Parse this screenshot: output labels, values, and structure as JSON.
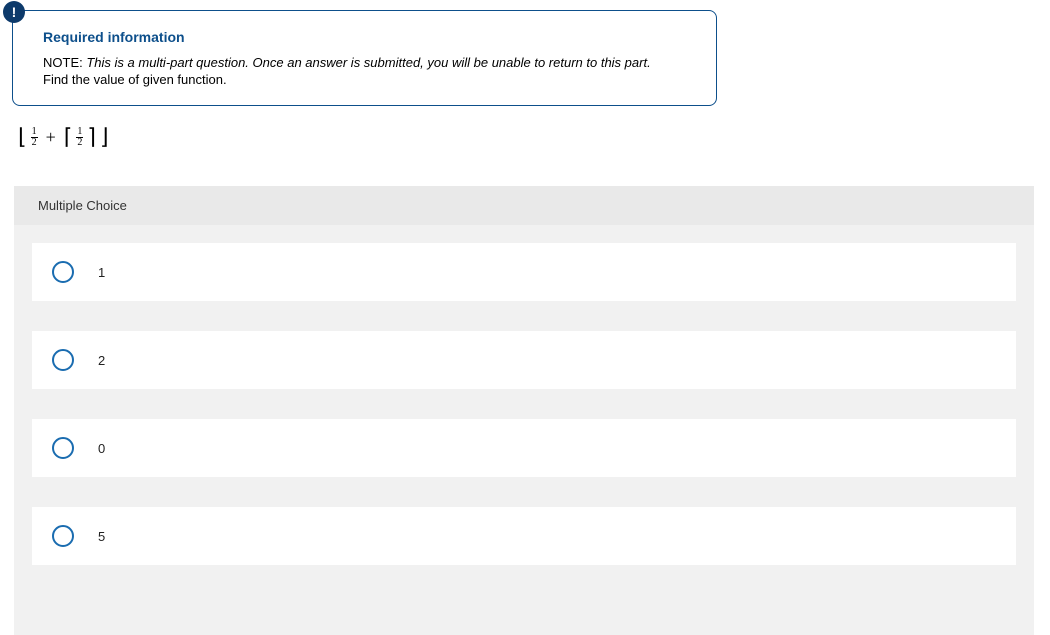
{
  "info": {
    "badge": "!",
    "title": "Required information",
    "note_label": "NOTE:",
    "note_text": "This is a multi-part question. Once an answer is submitted, you will be unable to return to this part.",
    "sub": "Find the value of given function."
  },
  "expression": {
    "frac1_num": "1",
    "frac1_den": "2",
    "plus": "+",
    "frac2_num": "1",
    "frac2_den": "2"
  },
  "mc": {
    "header": "Multiple Choice",
    "options": [
      "1",
      "2",
      "0",
      "5"
    ]
  }
}
